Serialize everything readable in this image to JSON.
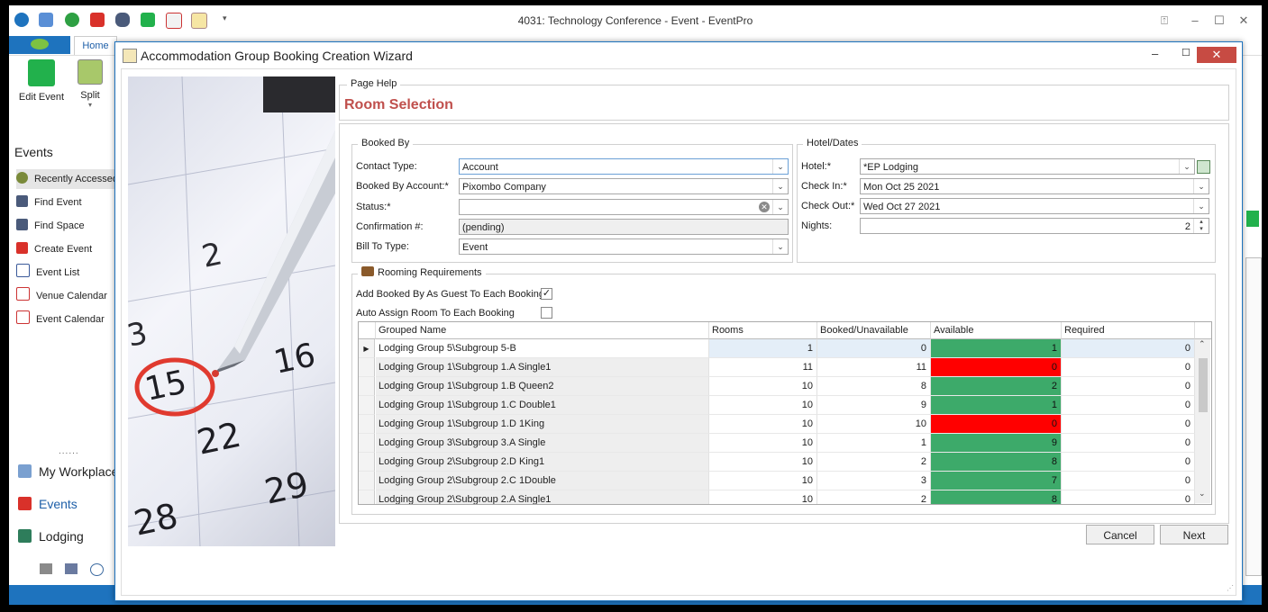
{
  "app": {
    "title": "4031: Technology Conference - Event - EventPro",
    "home_tab": "Home",
    "ribbon": {
      "edit_event": "Edit Event",
      "split": "Split"
    },
    "quick_access_icons": [
      "eventpro-logo-icon",
      "mail-icon",
      "refresh-icon",
      "close-red-icon",
      "binoculars-icon",
      "gear-green-icon",
      "calendar-icon",
      "clipboard-icon"
    ]
  },
  "nav": {
    "title": "Events",
    "items": [
      {
        "label": "Recently Accessed",
        "icon": "clock-icon"
      },
      {
        "label": "Find Event",
        "icon": "binoculars-icon"
      },
      {
        "label": "Find Space",
        "icon": "binoculars-icon"
      },
      {
        "label": "Create Event",
        "icon": "pin-icon"
      },
      {
        "label": "Event List",
        "icon": "list-icon"
      },
      {
        "label": "Venue Calendar",
        "icon": "calendar-icon"
      },
      {
        "label": "Event Calendar",
        "icon": "calendar-icon"
      }
    ],
    "splitter": "......",
    "big_items": [
      {
        "label": "My Workplace",
        "icon": "house-icon"
      },
      {
        "label": "Events",
        "icon": "pin-icon"
      },
      {
        "label": "Lodging",
        "icon": "bed-icon"
      }
    ]
  },
  "dialog": {
    "title": "Accommodation Group Booking Creation Wizard",
    "page_help_label": "Page Help",
    "page_title": "Room Selection",
    "calendar_numbers": [
      "2",
      "3",
      "15",
      "16",
      "22",
      "29",
      "28"
    ],
    "booked_by": {
      "legend": "Booked By",
      "contact_type_label": "Contact Type:",
      "contact_type_value": "Account",
      "account_label": "Booked By Account:*",
      "account_value": "Pixombo Company",
      "status_label": "Status:*",
      "status_value": "",
      "confirmation_label": "Confirmation #:",
      "confirmation_value": "(pending)",
      "bill_to_label": "Bill To Type:",
      "bill_to_value": "Event"
    },
    "hotel": {
      "legend": "Hotel/Dates",
      "hotel_label": "Hotel:*",
      "hotel_value": "*EP Lodging",
      "checkin_label": "Check In:*",
      "checkin_value": "Mon Oct 25 2021",
      "checkout_label": "Check Out:*",
      "checkout_value": "Wed Oct 27 2021",
      "nights_label": "Nights:",
      "nights_value": "2"
    },
    "rooming": {
      "legend": "Rooming Requirements",
      "add_guest_label": "Add Booked By As Guest To Each Booking",
      "add_guest_checked": true,
      "auto_assign_label": "Auto Assign Room To Each Booking",
      "auto_assign_checked": false,
      "columns": [
        "Grouped Name",
        "Rooms",
        "Booked/Unavailable",
        "Available",
        "Required"
      ],
      "rows": [
        {
          "name": "Lodging Group 5\\Subgroup 5-B",
          "rooms": "1",
          "booked": "0",
          "available": "1",
          "required": "0",
          "status": "ok"
        },
        {
          "name": "Lodging Group 1\\Subgroup 1.A Single1",
          "rooms": "11",
          "booked": "11",
          "available": "0",
          "required": "0",
          "status": "full"
        },
        {
          "name": "Lodging Group 1\\Subgroup 1.B Queen2",
          "rooms": "10",
          "booked": "8",
          "available": "2",
          "required": "0",
          "status": "ok"
        },
        {
          "name": "Lodging Group 1\\Subgroup 1.C Double1",
          "rooms": "10",
          "booked": "9",
          "available": "1",
          "required": "0",
          "status": "ok"
        },
        {
          "name": "Lodging Group 1\\Subgroup 1.D  1King",
          "rooms": "10",
          "booked": "10",
          "available": "0",
          "required": "0",
          "status": "full"
        },
        {
          "name": "Lodging Group 3\\Subgroup 3.A Single",
          "rooms": "10",
          "booked": "1",
          "available": "9",
          "required": "0",
          "status": "ok"
        },
        {
          "name": "Lodging Group 2\\Subgroup 2.D King1",
          "rooms": "10",
          "booked": "2",
          "available": "8",
          "required": "0",
          "status": "ok"
        },
        {
          "name": "Lodging Group 2\\Subgroup 2.C  1Double",
          "rooms": "10",
          "booked": "3",
          "available": "7",
          "required": "0",
          "status": "ok"
        },
        {
          "name": "Lodging Group 2\\Subgroup 2.A Single1",
          "rooms": "10",
          "booked": "2",
          "available": "8",
          "required": "0",
          "status": "ok"
        }
      ]
    },
    "cancel_label": "Cancel",
    "next_label": "Next"
  },
  "colors": {
    "available_ok": "#3daa6a",
    "available_full": "#ff0000",
    "accent_blue": "#1e73be",
    "title_red": "#c0504d"
  }
}
